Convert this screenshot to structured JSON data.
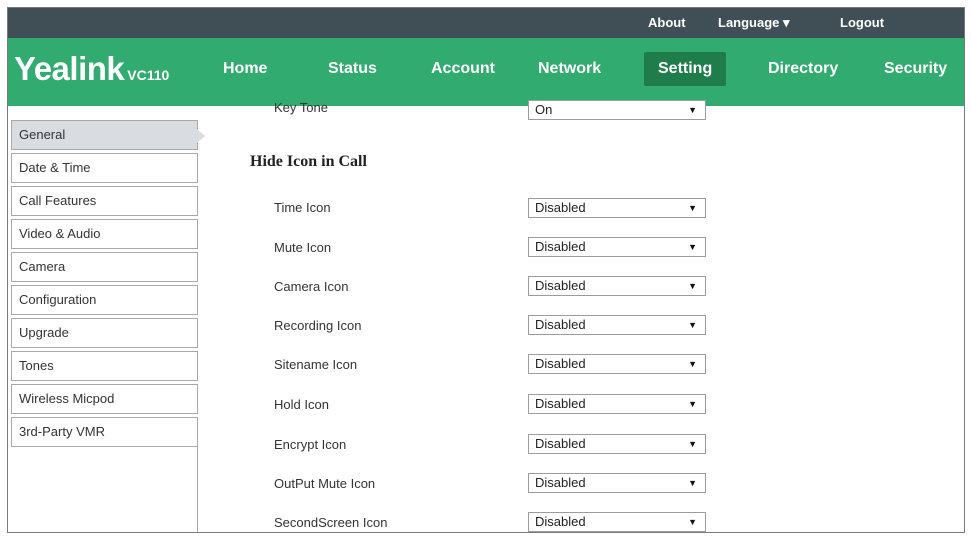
{
  "top_links": {
    "about": "About",
    "language": "Language ▾",
    "logout": "Logout"
  },
  "logo": {
    "brand": "Yealink",
    "model": "VC110"
  },
  "nav": [
    "Home",
    "Status",
    "Account",
    "Network",
    "Setting",
    "Directory",
    "Security"
  ],
  "nav_active": "Setting",
  "sidebar": [
    "General",
    "Date & Time",
    "Call Features",
    "Video & Audio",
    "Camera",
    "Configuration",
    "Upgrade",
    "Tones",
    "Wireless Micpod",
    "3rd-Party VMR"
  ],
  "sidebar_active": "General",
  "key_tone": {
    "label": "Key Tone",
    "value": "On"
  },
  "section": {
    "title": "Hide Icon in Call"
  },
  "rows": [
    {
      "label": "Time Icon",
      "value": "Disabled"
    },
    {
      "label": "Mute Icon",
      "value": "Disabled"
    },
    {
      "label": "Camera Icon",
      "value": "Disabled"
    },
    {
      "label": "Recording Icon",
      "value": "Disabled"
    },
    {
      "label": "Sitename Icon",
      "value": "Disabled"
    },
    {
      "label": "Hold Icon",
      "value": "Disabled"
    },
    {
      "label": "Encrypt Icon",
      "value": "Disabled"
    },
    {
      "label": "OutPut Mute Icon",
      "value": "Disabled"
    },
    {
      "label": "SecondScreen Icon",
      "value": "Disabled"
    }
  ],
  "icons": {
    "dropdown": "caret-down-icon",
    "language_menu": "caret-down-icon"
  },
  "colors": {
    "topbar": "#3f4f55",
    "navbar": "#31ab6f",
    "active_tab": "#1f7d4b",
    "sidebar_active": "#d9dde2"
  }
}
